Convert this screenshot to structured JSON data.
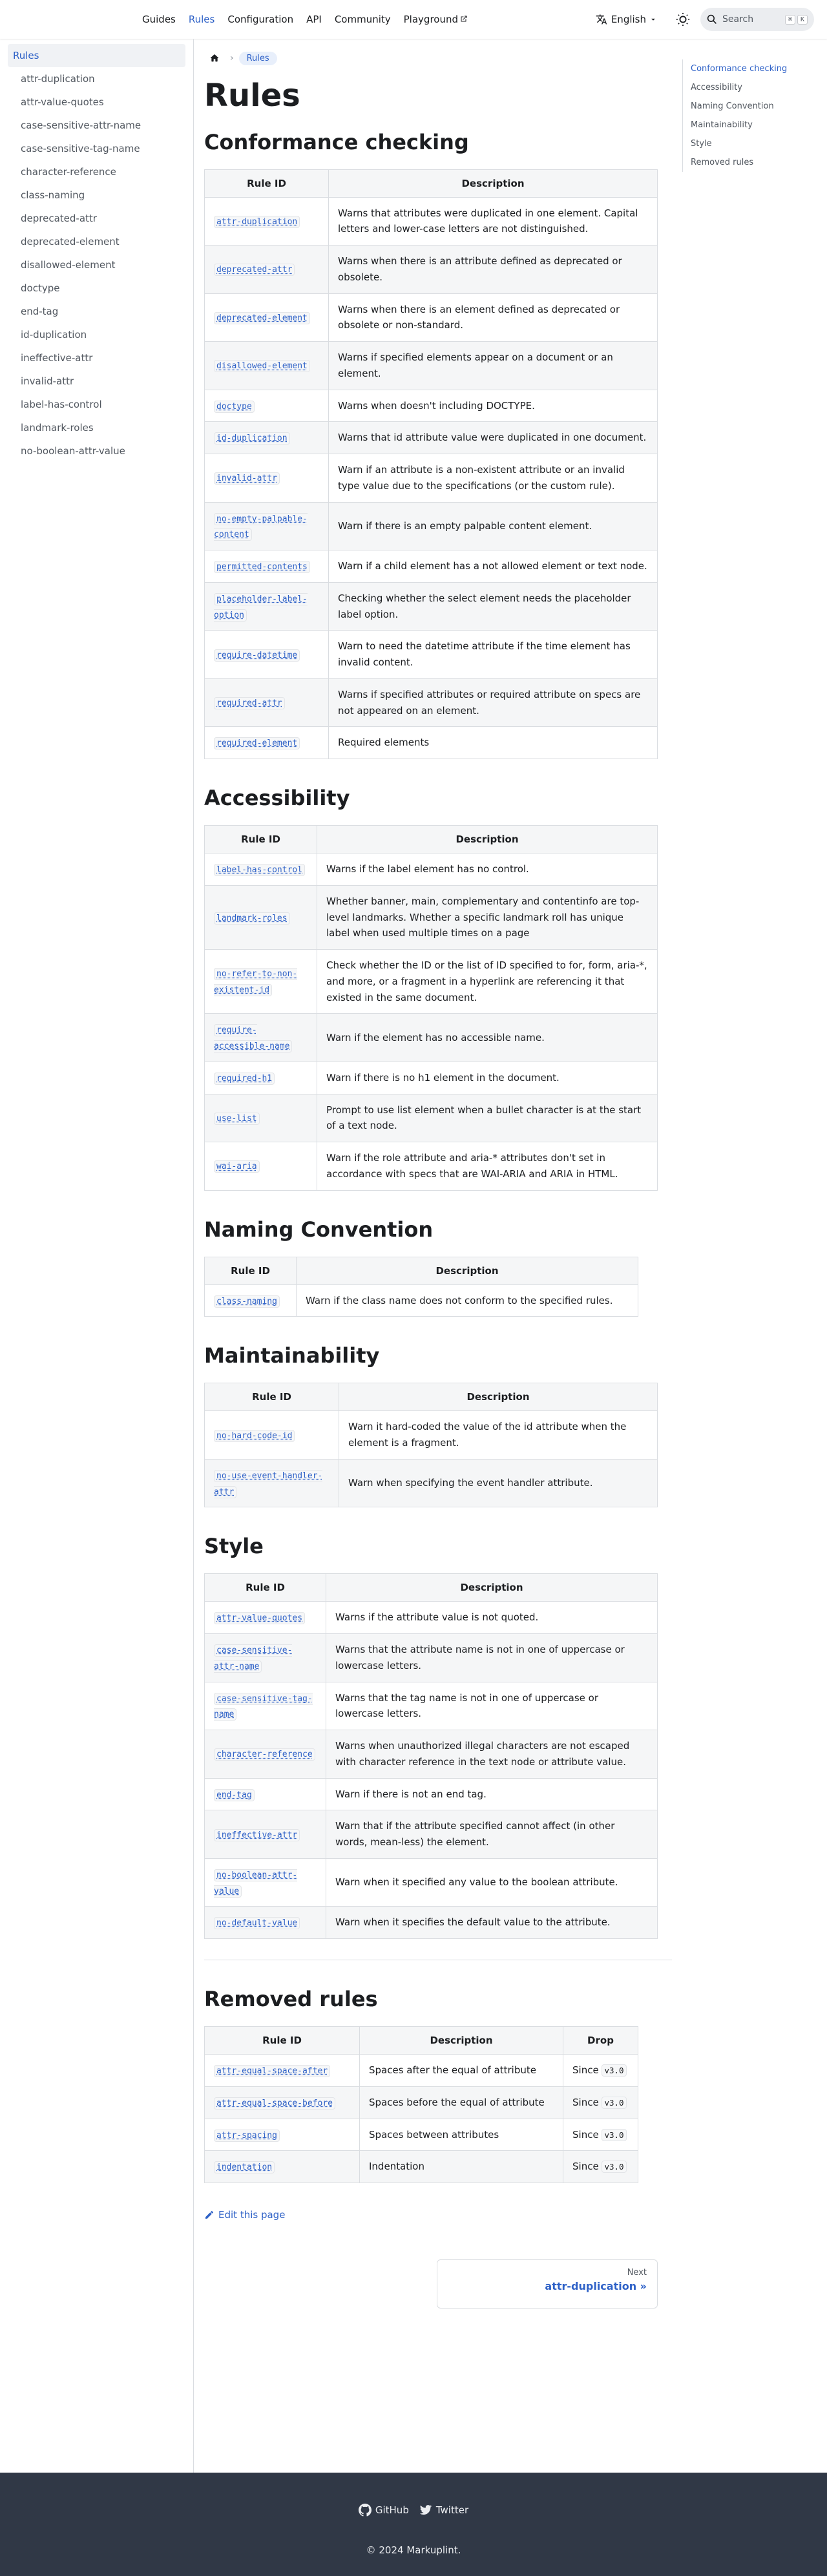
{
  "navbar": {
    "links": [
      "Guides",
      "Rules",
      "Configuration",
      "API",
      "Community",
      "Playground"
    ],
    "language": "English",
    "search_label": "Search",
    "search_keys": [
      "⌘",
      "K"
    ]
  },
  "sidebar": {
    "items": [
      "Rules",
      "attr-duplication",
      "attr-value-quotes",
      "case-sensitive-attr-name",
      "case-sensitive-tag-name",
      "character-reference",
      "class-naming",
      "deprecated-attr",
      "deprecated-element",
      "disallowed-element",
      "doctype",
      "end-tag",
      "id-duplication",
      "ineffective-attr",
      "invalid-attr",
      "label-has-control",
      "landmark-roles",
      "no-boolean-attr-value"
    ]
  },
  "breadcrumb": {
    "current": "Rules"
  },
  "page_title": "Rules",
  "table_headers": {
    "rule_id": "Rule ID",
    "description": "Description",
    "drop": "Drop"
  },
  "sections": {
    "conformance": {
      "title": "Conformance checking",
      "rows": [
        [
          "attr-duplication",
          "Warns that attributes were duplicated in one element. Capital letters and lower-case letters are not distinguished."
        ],
        [
          "deprecated-attr",
          "Warns when there is an attribute defined as deprecated or obsolete."
        ],
        [
          "deprecated-element",
          "Warns when there is an element defined as deprecated or obsolete or non-standard."
        ],
        [
          "disallowed-element",
          "Warns if specified elements appear on a document or an element."
        ],
        [
          "doctype",
          "Warns when doesn't including DOCTYPE."
        ],
        [
          "id-duplication",
          "Warns that id attribute value were duplicated in one document."
        ],
        [
          "invalid-attr",
          "Warn if an attribute is a non-existent attribute or an invalid type value due to the specifications (or the custom rule)."
        ],
        [
          "no-empty-palpable-content",
          "Warn if there is an empty palpable content element."
        ],
        [
          "permitted-contents",
          "Warn if a child element has a not allowed element or text node."
        ],
        [
          "placeholder-label-option",
          "Checking whether the select element needs the placeholder label option."
        ],
        [
          "require-datetime",
          "Warn to need the datetime attribute if the time element has invalid content."
        ],
        [
          "required-attr",
          "Warns if specified attributes or required attribute on specs are not appeared on an element."
        ],
        [
          "required-element",
          "Required elements"
        ]
      ]
    },
    "accessibility": {
      "title": "Accessibility",
      "rows": [
        [
          "label-has-control",
          "Warns if the label element has no control."
        ],
        [
          "landmark-roles",
          "Whether banner, main, complementary and contentinfo are top-level landmarks. Whether a specific landmark roll has unique label when used multiple times on a page"
        ],
        [
          "no-refer-to-non-existent-id",
          "Check whether the ID or the list of ID specified to for, form, aria-*, and more, or a fragment in a hyperlink are referencing it that existed in the same document."
        ],
        [
          "require-accessible-name",
          "Warn if the element has no accessible name."
        ],
        [
          "required-h1",
          "Warn if there is no h1 element in the document."
        ],
        [
          "use-list",
          "Prompt to use list element when a bullet character is at the start of a text node."
        ],
        [
          "wai-aria",
          "Warn if the role attribute and aria-* attributes don't set in accordance with specs that are WAI-ARIA and ARIA in HTML."
        ]
      ]
    },
    "naming": {
      "title": "Naming Convention",
      "rows": [
        [
          "class-naming",
          "Warn if the class name does not conform to the specified rules."
        ]
      ]
    },
    "maintainability": {
      "title": "Maintainability",
      "rows": [
        [
          "no-hard-code-id",
          "Warn it hard-coded the value of the id attribute when the element is a fragment."
        ],
        [
          "no-use-event-handler-attr",
          "Warn when specifying the event handler attribute."
        ]
      ]
    },
    "style": {
      "title": "Style",
      "rows": [
        [
          "attr-value-quotes",
          "Warns if the attribute value is not quoted."
        ],
        [
          "case-sensitive-attr-name",
          "Warns that the attribute name is not in one of uppercase or lowercase letters."
        ],
        [
          "case-sensitive-tag-name",
          "Warns that the tag name is not in one of uppercase or lowercase letters."
        ],
        [
          "character-reference",
          "Warns when unauthorized illegal characters are not escaped with character reference in the text node or attribute value."
        ],
        [
          "end-tag",
          "Warn if there is not an end tag."
        ],
        [
          "ineffective-attr",
          "Warn that if the attribute specified cannot affect (in other words, mean-less) the element."
        ],
        [
          "no-boolean-attr-value",
          "Warn when it specified any value to the boolean attribute."
        ],
        [
          "no-default-value",
          "Warn when it specifies the default value to the attribute."
        ]
      ]
    },
    "removed": {
      "title": "Removed rules",
      "rows": [
        [
          "attr-equal-space-after",
          "Spaces after the equal of attribute",
          "v3.0"
        ],
        [
          "attr-equal-space-before",
          "Spaces before the equal of attribute",
          "v3.0"
        ],
        [
          "attr-spacing",
          "Spaces between attributes",
          "v3.0"
        ],
        [
          "indentation",
          "Indentation",
          "v3.0"
        ]
      ],
      "since_prefix": "Since"
    }
  },
  "edit_link": "Edit this page",
  "pagination": {
    "sublabel": "Next",
    "label": "attr-duplication »"
  },
  "toc": [
    "Conformance checking",
    "Accessibility",
    "Naming Convention",
    "Maintainability",
    "Style",
    "Removed rules"
  ],
  "footer": {
    "links": [
      "GitHub",
      "Twitter"
    ],
    "copyright": "© 2024 Markuplint."
  },
  "colors": {
    "accent": "#2e61c7",
    "footer_bg": "#303846"
  }
}
